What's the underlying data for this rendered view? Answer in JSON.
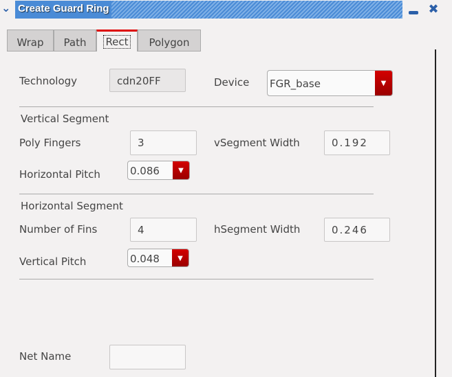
{
  "window": {
    "title": "Create Guard Ring",
    "menu_icon": "chevron-down-icon",
    "minimize_icon": "minimize-icon",
    "close_icon": "close-icon"
  },
  "tabs": [
    {
      "label": "Wrap"
    },
    {
      "label": "Path"
    },
    {
      "label": "Rect",
      "active": true
    },
    {
      "label": "Polygon"
    }
  ],
  "form": {
    "technology_label": "Technology",
    "technology_value": "cdn20FF",
    "device_label": "Device",
    "device_value": "FGR_base",
    "vertical_segment": {
      "heading": "Vertical Segment",
      "poly_fingers_label": "Poly Fingers",
      "poly_fingers_value": "3",
      "vsegment_width_label": "vSegment Width",
      "vsegment_width_value": "0.192",
      "horizontal_pitch_label": "Horizontal Pitch",
      "horizontal_pitch_value": "0.086"
    },
    "horizontal_segment": {
      "heading": "Horizontal Segment",
      "num_fins_label": "Number of Fins",
      "num_fins_value": "4",
      "hsegment_width_label": "hSegment Width",
      "hsegment_width_value": "0.246",
      "vertical_pitch_label": "Vertical Pitch",
      "vertical_pitch_value": "0.048"
    },
    "net_name_label": "Net Name",
    "net_name_value": ""
  },
  "colors": {
    "accent": "#d00000",
    "titlebar": "#4a8bd6"
  }
}
